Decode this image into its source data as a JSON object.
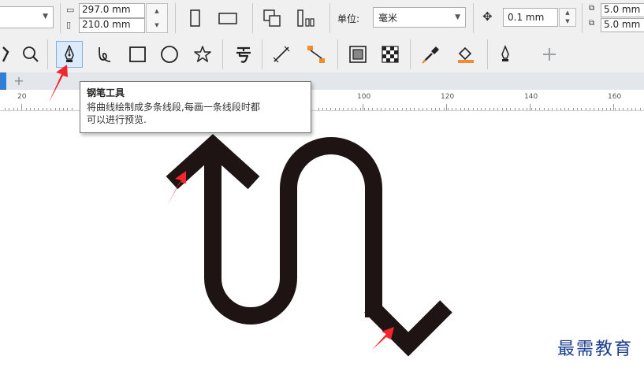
{
  "property_bar": {
    "width_value": "297.0 mm",
    "height_value": "210.0 mm",
    "units_label": "单位:",
    "units_value": "毫米",
    "nudge_value": "0.1 mm",
    "dup_x_value": "5.0 mm",
    "dup_y_value": "5.0 mm"
  },
  "tooltip": {
    "title": "钢笔工具",
    "line1": "将曲线绘制成多条线段,每画一条线段时都",
    "line2": "可以进行预览."
  },
  "tabs": {
    "add_label": "+"
  },
  "ruler": {
    "labels": [
      "20",
      "100",
      "120",
      "140",
      "160"
    ]
  },
  "watermark": "最需教育",
  "colors": {
    "accent": "#2f7fd6",
    "arrow_stroke": "#1e1414",
    "annotation": "#f2262c",
    "toolbar_bg": "#f0f0f0"
  },
  "icons": {
    "active_tool": "pen-tool-icon"
  }
}
